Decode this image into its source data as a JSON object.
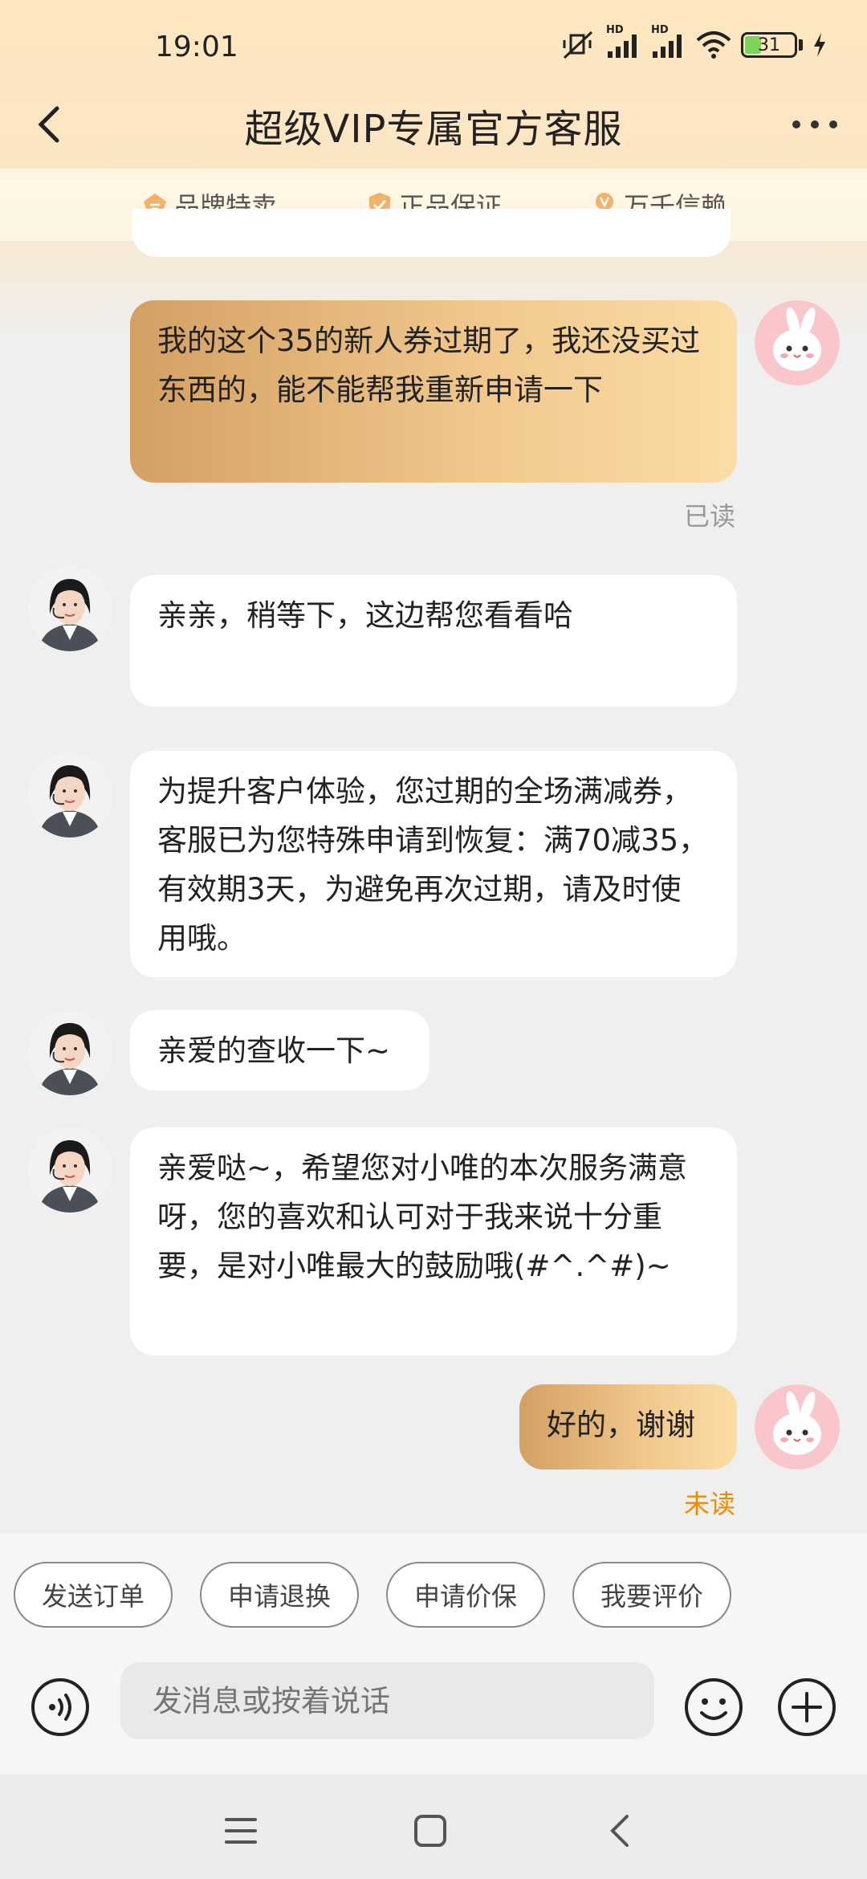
{
  "status_bar": {
    "time": "19:01",
    "signal1_label": "HD",
    "signal2_label": "HD",
    "battery": "31"
  },
  "header": {
    "title": "超级VIP专属官方客服"
  },
  "badges": [
    {
      "label": "品牌特卖",
      "icon": "tag-icon"
    },
    {
      "label": "正品保证",
      "icon": "shield-check-icon"
    },
    {
      "label": "万千信赖",
      "icon": "v-medal-icon"
    }
  ],
  "messages": [
    {
      "from": "me",
      "text": "我的这个35的新人券过期了，我还没买过东西的，能不能帮我重新申请一下",
      "status": "已读"
    },
    {
      "from": "agent",
      "text": "亲亲，稍等下，这边帮您看看哈"
    },
    {
      "from": "agent",
      "text": "为提升客户体验，您过期的全场满减券，客服已为您特殊申请到恢复：满70减35，有效期3天，为避免再次过期，请及时使用哦。"
    },
    {
      "from": "agent",
      "text": "亲爱的查收一下~"
    },
    {
      "from": "agent",
      "text": "亲爱哒~，希望您对小唯的本次服务满意呀，您的喜欢和认可对于我来说十分重要，是对小唯最大的鼓励哦(#^.^#)~"
    },
    {
      "from": "me",
      "text": "好的，谢谢",
      "status": "未读"
    }
  ],
  "quick_actions": [
    "发送订单",
    "申请退换",
    "申请价保",
    "我要评价"
  ],
  "input": {
    "placeholder": "发消息或按着说话"
  },
  "colors": {
    "read": "#999999",
    "unread": "#f08a00",
    "bubble_me": "#e9b873",
    "bubble_agent": "#ffffff"
  }
}
